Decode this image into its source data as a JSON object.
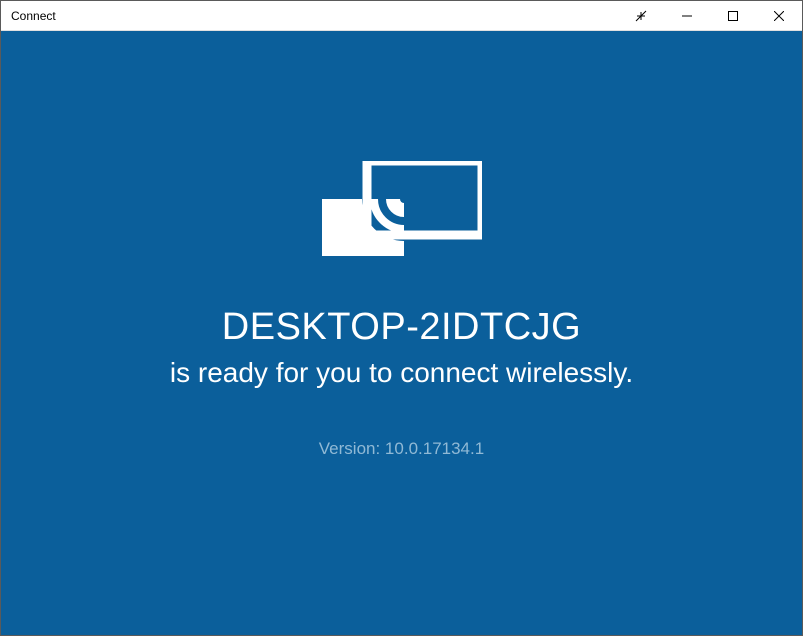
{
  "titlebar": {
    "title": "Connect"
  },
  "content": {
    "device_name": "DESKTOP-2IDTCJG",
    "ready_text": "is ready for you to connect wirelessly.",
    "version_label": "Version: 10.0.17134.1"
  }
}
